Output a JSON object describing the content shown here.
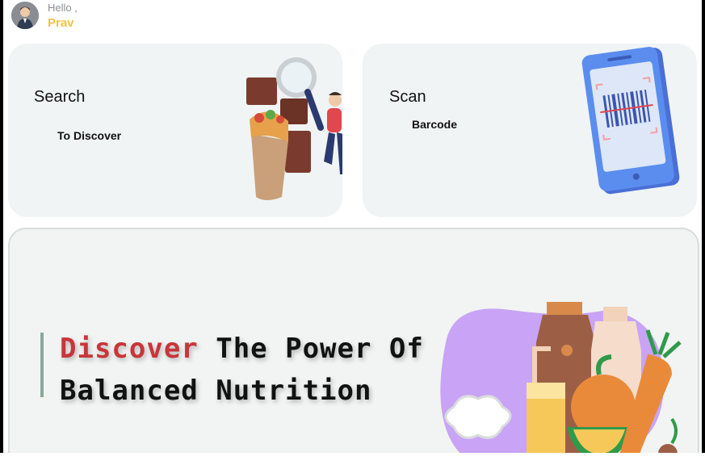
{
  "header": {
    "greeting": "Hello ,",
    "username": "Prav"
  },
  "cards": {
    "search": {
      "title": "Search",
      "subtitle": "To Discover"
    },
    "scan": {
      "title": "Scan",
      "subtitle": "Barcode"
    }
  },
  "banner": {
    "headline_accent": "Discover",
    "headline_rest1": " The Power Of",
    "headline_line2": "Balanced Nutrition"
  },
  "colors": {
    "accent_yellow": "#f3c242",
    "headline_red": "#c8353a",
    "card_bg": "#f1f4f4",
    "phone_blue": "#5b8def",
    "blob_purple": "#c9a3f5"
  },
  "icons": [
    "user-avatar-icon",
    "magnifier-food-illustration",
    "phone-barcode-illustration",
    "groceries-illustration"
  ]
}
